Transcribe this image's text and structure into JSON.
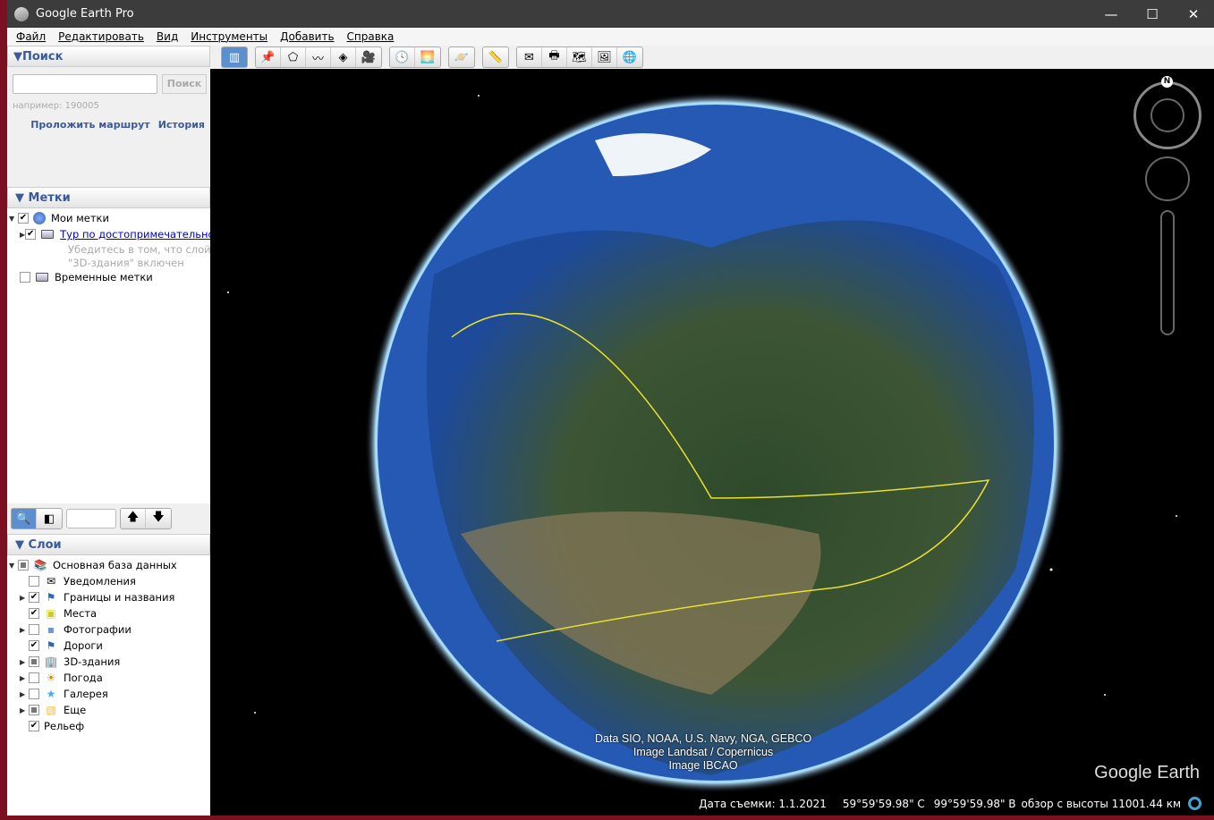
{
  "window": {
    "title": "Google Earth Pro",
    "minimize": "—",
    "maximize": "☐",
    "close": "✕"
  },
  "menu": [
    "Файл",
    "Редактировать",
    "Вид",
    "Инструменты",
    "Добавить",
    "Справка"
  ],
  "search": {
    "header": "Поиск",
    "placeholder": "",
    "button": "Поиск",
    "hint": "например: 190005",
    "route": "Проложить маршрут",
    "history": "История"
  },
  "places": {
    "header": "Метки",
    "items": [
      {
        "label": "Мои метки"
      },
      {
        "label": "Тур по достопримечательнс",
        "note1": "Убедитесь в том, что слой",
        "note2": "\"3D-здания\" включен"
      },
      {
        "label": "Временные метки"
      }
    ]
  },
  "layers": {
    "header": "Слои",
    "items": [
      {
        "label": "Основная база данных",
        "state": "partial"
      },
      {
        "label": "Уведомления",
        "state": "off"
      },
      {
        "label": "Границы и названия",
        "state": "on"
      },
      {
        "label": "Места",
        "state": "on"
      },
      {
        "label": "Фотографии",
        "state": "off"
      },
      {
        "label": "Дороги",
        "state": "on"
      },
      {
        "label": "3D-здания",
        "state": "partial"
      },
      {
        "label": "Погода",
        "state": "off"
      },
      {
        "label": "Галерея",
        "state": "off"
      },
      {
        "label": "Еще",
        "state": "partial"
      },
      {
        "label": "Рельеф",
        "state": "on"
      }
    ]
  },
  "map": {
    "attribution": [
      "Data SIO, NOAA, U.S. Navy, NGA, GEBCO",
      "Image Landsat / Copernicus",
      "Image IBCAO"
    ],
    "logo": "Google Earth",
    "compass_n": "N"
  },
  "status": {
    "date": "Дата съемки: 1.1.2021",
    "lat": "59°59'59.98\" С",
    "lon": "99°59'59.98\" В",
    "alt": "обзор с высоты 11001.44 км"
  }
}
